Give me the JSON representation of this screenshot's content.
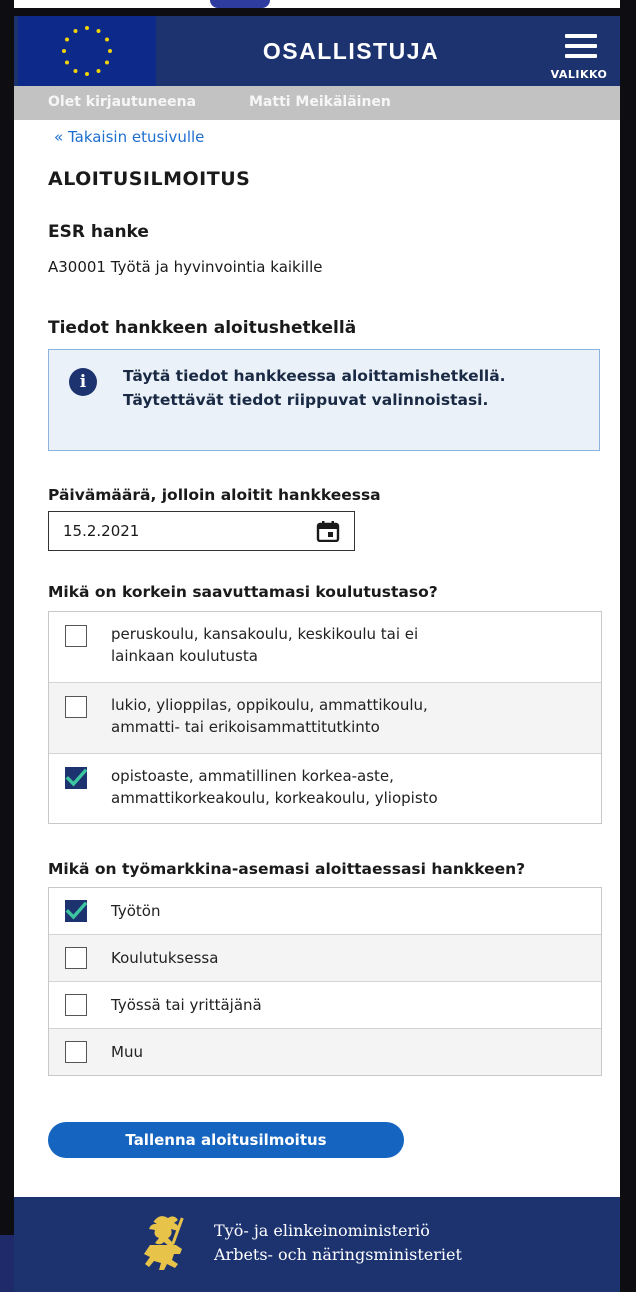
{
  "header": {
    "app_title": "OSALLISTUJA",
    "menu_label": "VALIKKO"
  },
  "login_bar": {
    "prefix": "Olet kirjautuneena",
    "user_name": "Matti Meikäläinen"
  },
  "back_link": "« Takaisin etusivulle",
  "page_title": "ALOITUSILMOITUS",
  "project": {
    "label": "ESR hanke",
    "value": "A30001 Työtä ja hyvinvointia kaikille"
  },
  "start_info": {
    "section_title": "Tiedot hankkeen aloitushetkellä",
    "info_lines": [
      "Täytä tiedot hankkeessa aloittamishetkellä.",
      "Täytettävät tiedot riippuvat valinnoistasi."
    ]
  },
  "date_field": {
    "label": "Päivämäärä, jolloin aloitit hankkeessa",
    "value": "15.2.2021"
  },
  "education": {
    "question": "Mikä on korkein saavuttamasi koulutustaso?",
    "options": [
      {
        "line1": "peruskoulu, kansakoulu, keskikoulu tai ei",
        "line2": "lainkaan koulutusta",
        "checked": false
      },
      {
        "line1": "lukio, ylioppilas, oppikoulu, ammattikoulu,",
        "line2": "ammatti- tai erikoisammattitutkinto",
        "checked": false
      },
      {
        "line1": "opistoaste, ammatillinen korkea-aste,",
        "line2": "ammattikorkeakoulu, korkeakoulu, yliopisto",
        "checked": true
      }
    ]
  },
  "employment": {
    "question": "Mikä on työmarkkina-asemasi aloittaessasi hankkeen?",
    "options": [
      {
        "label": "Työtön",
        "checked": true
      },
      {
        "label": "Koulutuksessa",
        "checked": false
      },
      {
        "label": "Työssä tai yrittäjänä",
        "checked": false
      },
      {
        "label": "Muu",
        "checked": false
      }
    ]
  },
  "save_button": "Tallenna aloitusilmoitus",
  "footer": {
    "line1": "Työ- ja elinkeinoministeriö",
    "line2": "Arbets- och näringsministeriet"
  },
  "colors": {
    "primary_navy": "#1c3370",
    "button_blue": "#1565c0",
    "link_blue": "#1f6fd0",
    "eu_blue": "#0d2a8a",
    "eu_star": "#f2d20a"
  },
  "icons": [
    "eu-flag-icon",
    "menu-icon",
    "info-icon",
    "calendar-icon",
    "checkmark-icon",
    "lion-crest-icon"
  ]
}
